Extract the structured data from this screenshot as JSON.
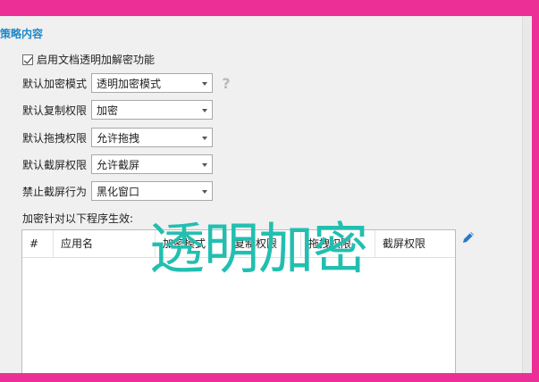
{
  "section": {
    "title": "策略内容"
  },
  "enable": {
    "checked": true,
    "label": "启用文档透明加解密功能"
  },
  "fields": [
    {
      "label": "默认加密模式",
      "value": "透明加密模式"
    },
    {
      "label": "默认复制权限",
      "value": "加密"
    },
    {
      "label": "默认拖拽权限",
      "value": "允许拖拽"
    },
    {
      "label": "默认截屏权限",
      "value": "允许截屏"
    },
    {
      "label": "禁止截屏行为",
      "value": "黑化窗口"
    }
  ],
  "help_glyph": "?",
  "programs": {
    "caption": "加密针对以下程序生效:",
    "columns": [
      "#",
      "应用名",
      "加密模式",
      "复制权限",
      "拖拽权限",
      "截屏权限"
    ],
    "rows": []
  },
  "overlay_text": "透明加密",
  "colors": {
    "frame": "#ec2f96",
    "panel": "#f0f0f0",
    "section_title": "#1e88c8",
    "overlay": "#22bfb0",
    "edit_icon": "#2a79c9"
  },
  "icons": {
    "edit": "pencil-icon",
    "help": "help-icon"
  }
}
